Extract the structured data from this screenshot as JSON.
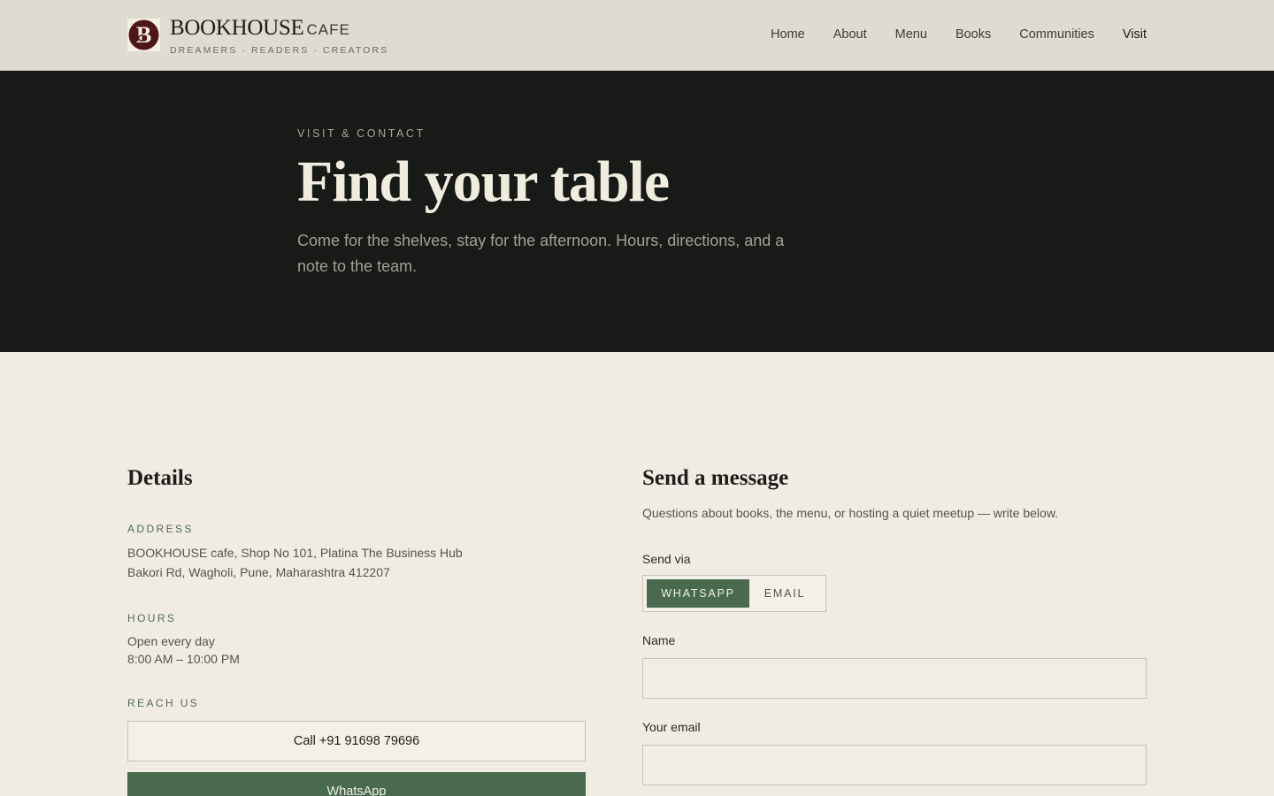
{
  "brand": {
    "name": "BOOKHOUSE",
    "suffix": "CAFE",
    "tagline": "DREAMERS · READERS · CREATORS"
  },
  "nav": {
    "items": [
      {
        "label": "Home"
      },
      {
        "label": "About"
      },
      {
        "label": "Menu"
      },
      {
        "label": "Books"
      },
      {
        "label": "Communities"
      },
      {
        "label": "Visit",
        "active": true
      }
    ]
  },
  "hero": {
    "eyebrow": "VISIT & CONTACT",
    "title": "Find your table",
    "subtitle": "Come for the shelves, stay for the afternoon. Hours, directions, and a note to the team."
  },
  "details": {
    "title": "Details",
    "address_label": "ADDRESS",
    "address_line1": "BOOKHOUSE cafe, Shop No 101, Platina The Business Hub",
    "address_line2": "Bakori Rd, Wagholi, Pune, Maharashtra 412207",
    "hours_label": "HOURS",
    "hours_line1": "Open every day",
    "hours_line2": "8:00 AM – 10:00 PM",
    "reach_label": "REACH US",
    "call_button": "Call +91 91698 79696",
    "whatsapp_button": "WhatsApp"
  },
  "message": {
    "title": "Send a message",
    "intro": "Questions about books, the menu, or hosting a quiet meetup — write below.",
    "send_via_label": "Send via",
    "options": [
      {
        "label": "WHATSAPP",
        "selected": true
      },
      {
        "label": "EMAIL",
        "selected": false
      }
    ],
    "name_label": "Name",
    "name_value": "",
    "email_label": "Your email",
    "email_value": ""
  },
  "colors": {
    "accent_green": "#4a6a50",
    "hero_bg": "#171a16",
    "page_bg": "#f1ece3",
    "logo_maroon": "#5a1a1a"
  }
}
